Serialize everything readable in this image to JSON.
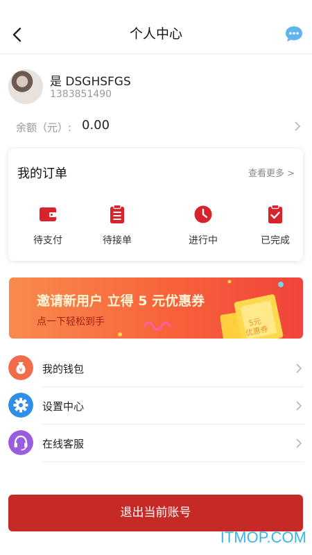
{
  "header": {
    "title": "个人中心",
    "back_icon": "chevron-left-icon",
    "chat_icon": "chat-bubble-icon",
    "chat_color": "#5fb4ec"
  },
  "profile": {
    "name": "是 DSGHSFGS",
    "phone": "1383851490"
  },
  "balance": {
    "label": "余额（元）:",
    "value": "0.00"
  },
  "orders": {
    "title": "我的订单",
    "more": "查看更多 >",
    "accent": "#d9232b",
    "items": [
      {
        "label": "待支付",
        "icon": "wallet-icon"
      },
      {
        "label": "待接单",
        "icon": "clipboard-icon"
      },
      {
        "label": "进行中",
        "icon": "clock-icon"
      },
      {
        "label": "已完成",
        "icon": "clipboard-check-icon"
      }
    ]
  },
  "banner": {
    "title": "邀请新用户 立得 5 元优惠券",
    "subtitle": "点一下轻松到手",
    "coupon_text_1": "5元",
    "coupon_text_2": "优惠券"
  },
  "menu": [
    {
      "label": "我的钱包",
      "icon": "money-bag-icon",
      "color": "#f26b4b"
    },
    {
      "label": "设置中心",
      "icon": "gear-icon",
      "color": "#2f8ee6"
    },
    {
      "label": "在线客服",
      "icon": "headset-icon",
      "color": "#9a5de0"
    }
  ],
  "logout": {
    "label": "退出当前账号",
    "color": "#c62a26"
  },
  "watermark": "ITMOP.COM"
}
